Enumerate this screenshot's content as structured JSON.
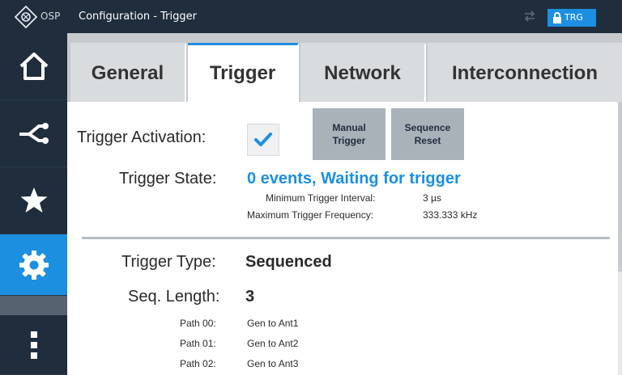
{
  "titlebar": {
    "app_name": "OSP",
    "window_title": "Configuration - Trigger",
    "badge_label": "TRG",
    "icons": {
      "logo": "rs-logo-icon",
      "network": "network-arrows-icon",
      "lock": "lock-icon"
    }
  },
  "nav": {
    "items": [
      {
        "name": "home",
        "icon": "home-icon",
        "active": false
      },
      {
        "name": "paths",
        "icon": "path-split-icon",
        "active": false
      },
      {
        "name": "favorites",
        "icon": "star-icon",
        "active": false
      },
      {
        "name": "settings",
        "icon": "gear-icon",
        "active": true
      },
      {
        "name": "more",
        "icon": "more-vertical-icon",
        "active": false
      }
    ]
  },
  "tabs": [
    {
      "label": "General",
      "active": false
    },
    {
      "label": "Trigger",
      "active": true
    },
    {
      "label": "Network",
      "active": false
    },
    {
      "label": "Interconnection",
      "active": false
    }
  ],
  "trigger": {
    "activation_label": "Trigger Activation:",
    "activation_checked": true,
    "manual_button": "Manual\nTrigger",
    "sequence_reset_button": "Sequence\nReset",
    "state_label": "Trigger State:",
    "state_value": "0 events, Waiting for trigger",
    "min_interval_label": "Minimum Trigger Interval:",
    "min_interval_value": "3 µs",
    "max_frequency_label": "Maximum Trigger Frequency:",
    "max_frequency_value": "333.333 kHz",
    "type_label": "Trigger Type:",
    "type_value": "Sequenced",
    "seq_length_label": "Seq. Length:",
    "seq_length_value": "3",
    "paths": [
      {
        "label": "Path 00:",
        "value": "Gen to Ant1"
      },
      {
        "label": "Path 01:",
        "value": "Gen to Ant2"
      },
      {
        "label": "Path 02:",
        "value": "Gen to Ant3"
      }
    ]
  },
  "colors": {
    "accent": "#1d8fe1",
    "navy": "#1f2d3d",
    "button": "#a9b1b9"
  }
}
